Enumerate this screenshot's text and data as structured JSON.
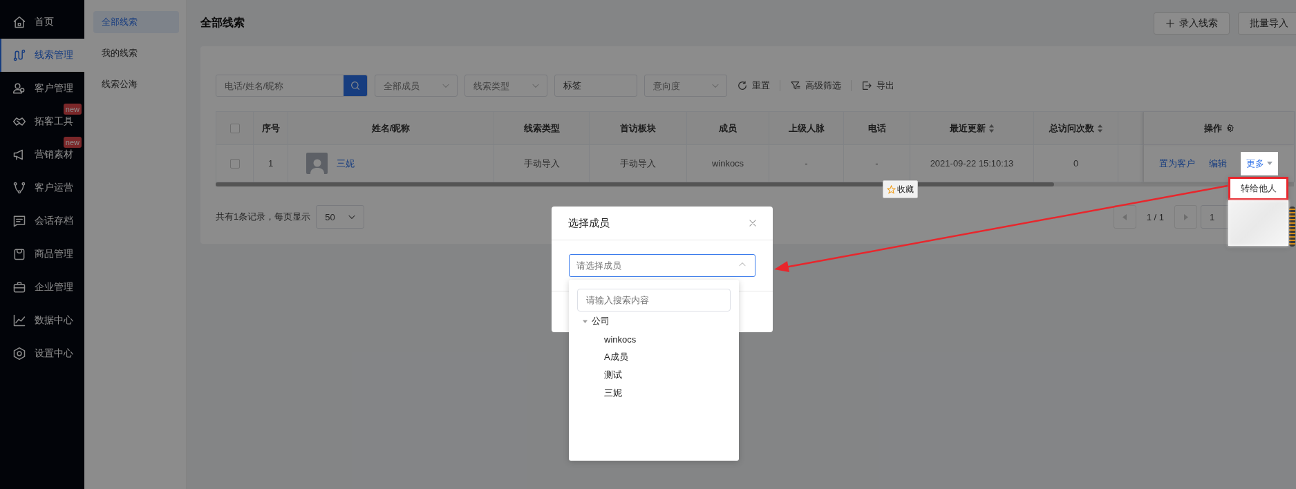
{
  "sidebar": {
    "items": [
      {
        "label": "首页",
        "selected": false
      },
      {
        "label": "线索管理",
        "selected": true
      },
      {
        "label": "客户管理",
        "selected": false
      },
      {
        "label": "拓客工具",
        "selected": false,
        "badge": "new"
      },
      {
        "label": "营销素材",
        "selected": false,
        "badge": "new"
      },
      {
        "label": "客户运营",
        "selected": false
      },
      {
        "label": "会话存档",
        "selected": false
      },
      {
        "label": "商品管理",
        "selected": false
      },
      {
        "label": "企业管理",
        "selected": false
      },
      {
        "label": "数据中心",
        "selected": false
      },
      {
        "label": "设置中心",
        "selected": false
      }
    ]
  },
  "submenu": {
    "items": [
      {
        "label": "全部线索",
        "selected": true
      },
      {
        "label": "我的线索",
        "selected": false
      },
      {
        "label": "线索公海",
        "selected": false
      }
    ]
  },
  "header": {
    "title": "全部线索",
    "buttons": [
      {
        "label": "录入线索",
        "kind": "add"
      },
      {
        "label": "批量导入",
        "kind": "plain"
      }
    ]
  },
  "filters": {
    "search": {
      "placeholder": "电话/姓名/昵称"
    },
    "fields": [
      {
        "kind": "select",
        "placeholder": "全部成员"
      },
      {
        "kind": "select",
        "placeholder": "线索类型"
      },
      {
        "kind": "input",
        "value": "标签"
      },
      {
        "kind": "select",
        "placeholder": "意向度"
      }
    ],
    "actions": [
      {
        "label": "重置",
        "kind": "reset"
      },
      {
        "label": "高级筛选",
        "kind": "filter"
      },
      {
        "label": "导出",
        "kind": "export"
      }
    ]
  },
  "table": {
    "select_all": {
      "checked": false
    },
    "columns": [
      {
        "label": "序号",
        "sortable": false
      },
      {
        "label": "姓名/昵称",
        "sortable": false
      },
      {
        "label": "线索类型",
        "sortable": false
      },
      {
        "label": "首访板块",
        "sortable": false
      },
      {
        "label": "成员",
        "sortable": false
      },
      {
        "label": "上级人脉",
        "sortable": false
      },
      {
        "label": "电话",
        "sortable": false
      },
      {
        "label": "最近更新",
        "sortable": true
      },
      {
        "label": "总访问次数",
        "sortable": true
      },
      {
        "label": "操作",
        "sortable": false,
        "kind": "actions"
      }
    ],
    "rows": [
      {
        "checked": false,
        "cells": [
          {
            "text": "1"
          },
          {
            "text": "三妮",
            "kind": "contact"
          },
          {
            "text": "手动导入"
          },
          {
            "text": "手动导入"
          },
          {
            "text": "winkocs"
          },
          {
            "text": "-"
          },
          {
            "text": "-"
          },
          {
            "text": "2021-09-22 15:10:13"
          },
          {
            "text": "0"
          }
        ],
        "actions": [
          {
            "label": "置为客户",
            "kind": "link"
          },
          {
            "label": "编辑",
            "kind": "link"
          },
          {
            "label": "更多",
            "kind": "menu"
          }
        ]
      }
    ]
  },
  "more_menu": {
    "items": [
      {
        "label": "转给他人",
        "highlighted": true
      }
    ]
  },
  "favorite_tooltip": {
    "label": "收藏"
  },
  "pagination": {
    "summary": "共有1条记录，每页显示",
    "page_size": "50",
    "pages": "1 / 1",
    "page_input": "1"
  },
  "modal": {
    "title": "选择成员",
    "select": {
      "placeholder": "请选择成员",
      "expanded": true
    },
    "dropdown": {
      "search": {
        "placeholder": "请输入搜索内容"
      },
      "tree": [
        {
          "label": "公司",
          "expanded": true,
          "children": [
            {
              "label": "winkocs"
            },
            {
              "label": "A成员"
            },
            {
              "label": "测试"
            },
            {
              "label": "三妮"
            }
          ]
        }
      ]
    }
  }
}
